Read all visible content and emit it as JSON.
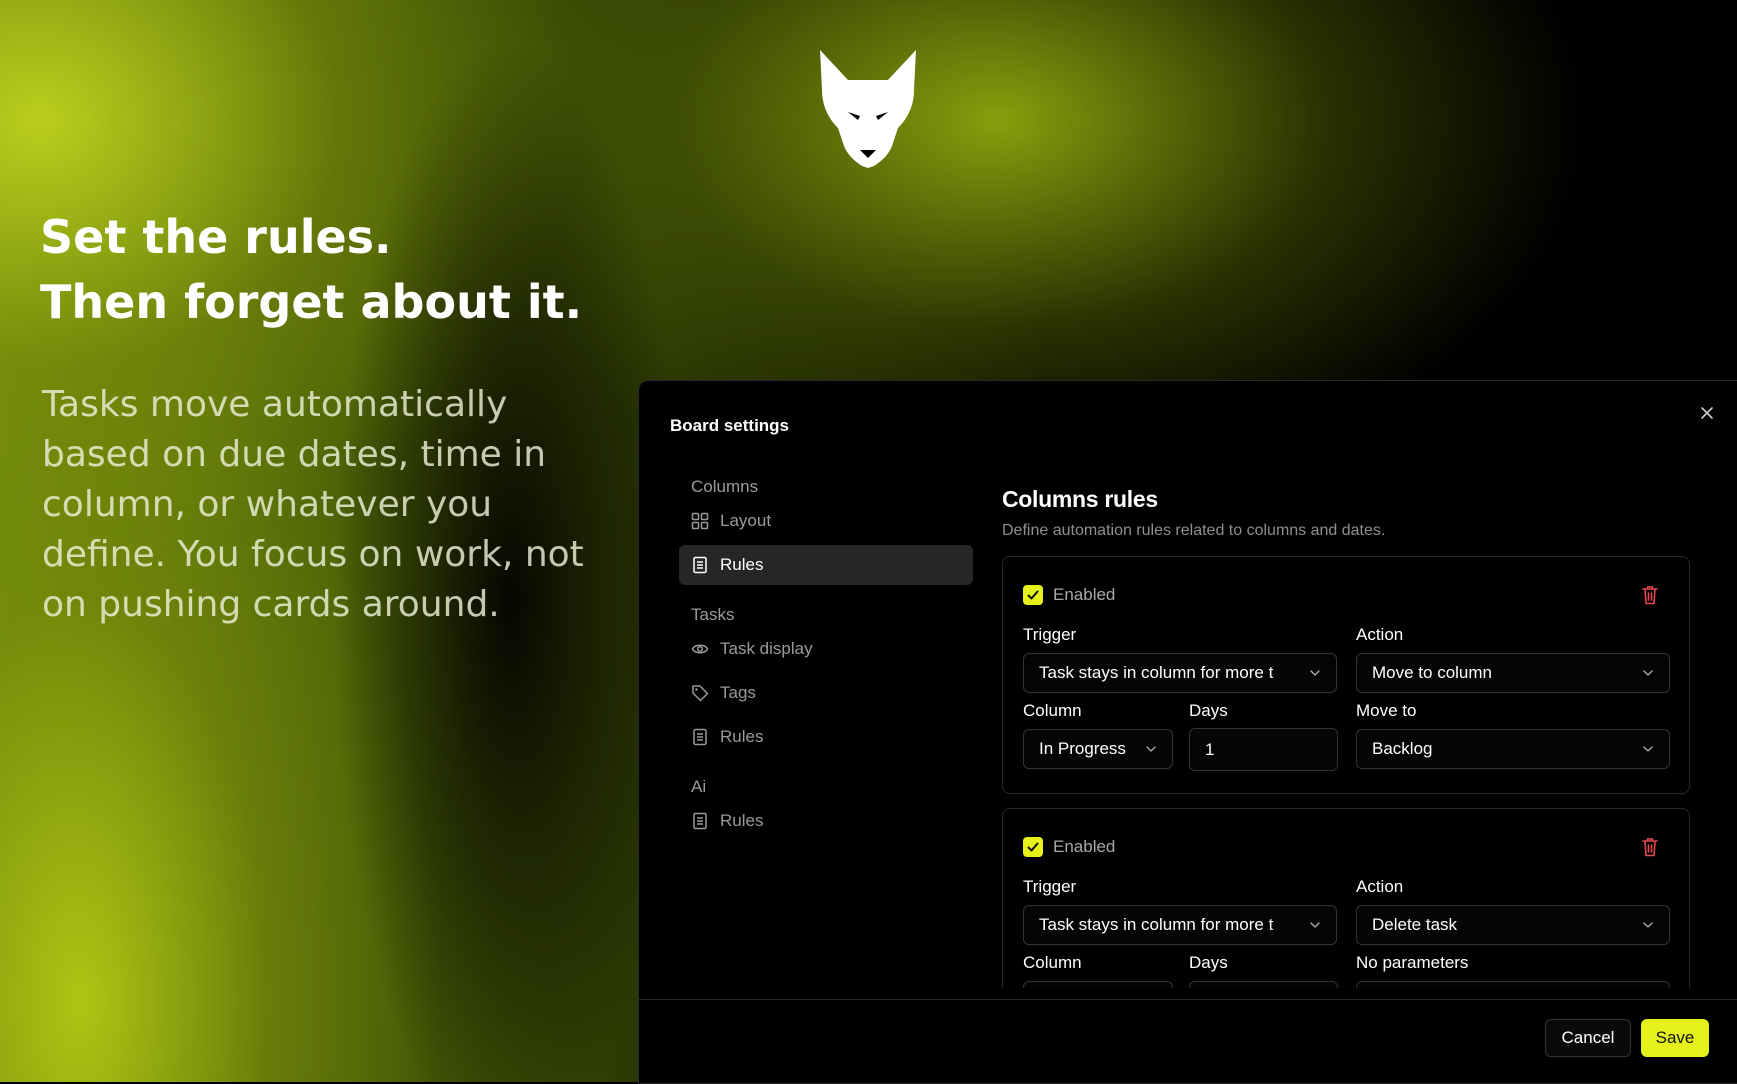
{
  "hero": {
    "title_line1": "Set the rules.",
    "title_line2": "Then forget about it.",
    "body": "Tasks move automatically based on due dates, time in column, or whatever you define. You focus on work, not on pushing cards around."
  },
  "modal": {
    "title": "Board settings",
    "close_icon": "close-icon",
    "nav": {
      "groups": [
        {
          "label": "Columns",
          "items": [
            {
              "label": "Layout",
              "icon": "grid-icon"
            },
            {
              "label": "Rules",
              "icon": "document-icon",
              "active": true
            }
          ]
        },
        {
          "label": "Tasks",
          "items": [
            {
              "label": "Task display",
              "icon": "eye-icon"
            },
            {
              "label": "Tags",
              "icon": "tag-icon"
            },
            {
              "label": "Rules",
              "icon": "document-icon"
            }
          ]
        },
        {
          "label": "Ai",
          "items": [
            {
              "label": "Rules",
              "icon": "document-icon"
            }
          ]
        }
      ]
    },
    "content": {
      "title": "Columns rules",
      "description": "Define automation rules related to columns and dates.",
      "rules": [
        {
          "enabled_label": "Enabled",
          "trigger_label": "Trigger",
          "trigger_value": "Task stays in column for more t",
          "action_label": "Action",
          "action_value": "Move to column",
          "column_label": "Column",
          "column_value": "In Progress",
          "days_label": "Days",
          "days_value": "1",
          "param_label": "Move to",
          "param_value": "Backlog"
        },
        {
          "enabled_label": "Enabled",
          "trigger_label": "Trigger",
          "trigger_value": "Task stays in column for more t",
          "action_label": "Action",
          "action_value": "Delete task",
          "column_label": "Column",
          "days_label": "Days",
          "param_label": "No parameters"
        }
      ]
    },
    "footer": {
      "cancel_label": "Cancel",
      "save_label": "Save"
    }
  },
  "colors": {
    "accent": "#e4f11a",
    "danger": "#e5484d",
    "background": "#000000",
    "brand_gradient": "#9db814"
  }
}
